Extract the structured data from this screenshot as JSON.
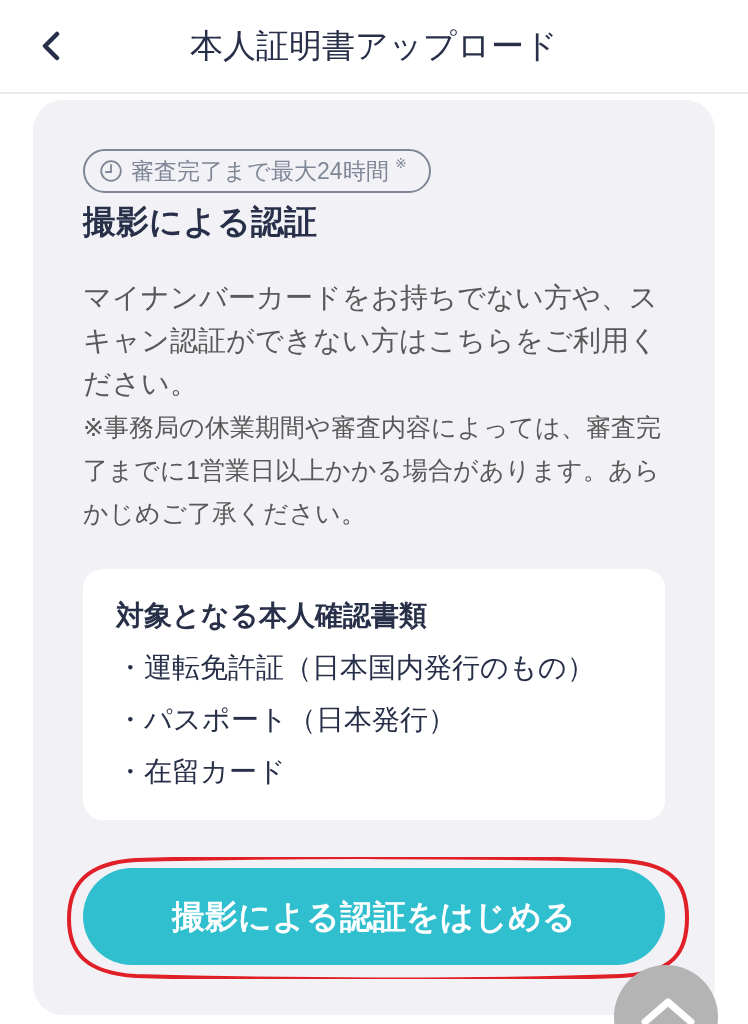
{
  "header": {
    "title": "本人証明書アップロード"
  },
  "verification": {
    "badge": "審査完了まで最大24時間 $^{※}$",
    "title": "撮影による認証",
    "description": "マイナンバーカードをお持ちでない方や、スキャン認証ができない方はこちらをご利用ください。",
    "note": "※事務局の休業期間や審査内容によっては、審査完了までに1営業日以上かかる場合があります。あらかじめご了承ください。",
    "documents": {
      "heading": "対象となる本人確認書類",
      "items": [
        "・運転免許証（日本国内発行のもの）",
        "・パスポート（日本発行）",
        "・在留カード"
      ]
    },
    "button": {
      "label": "撮影による認証をはじめる",
      "highlighted": true
    }
  }
}
